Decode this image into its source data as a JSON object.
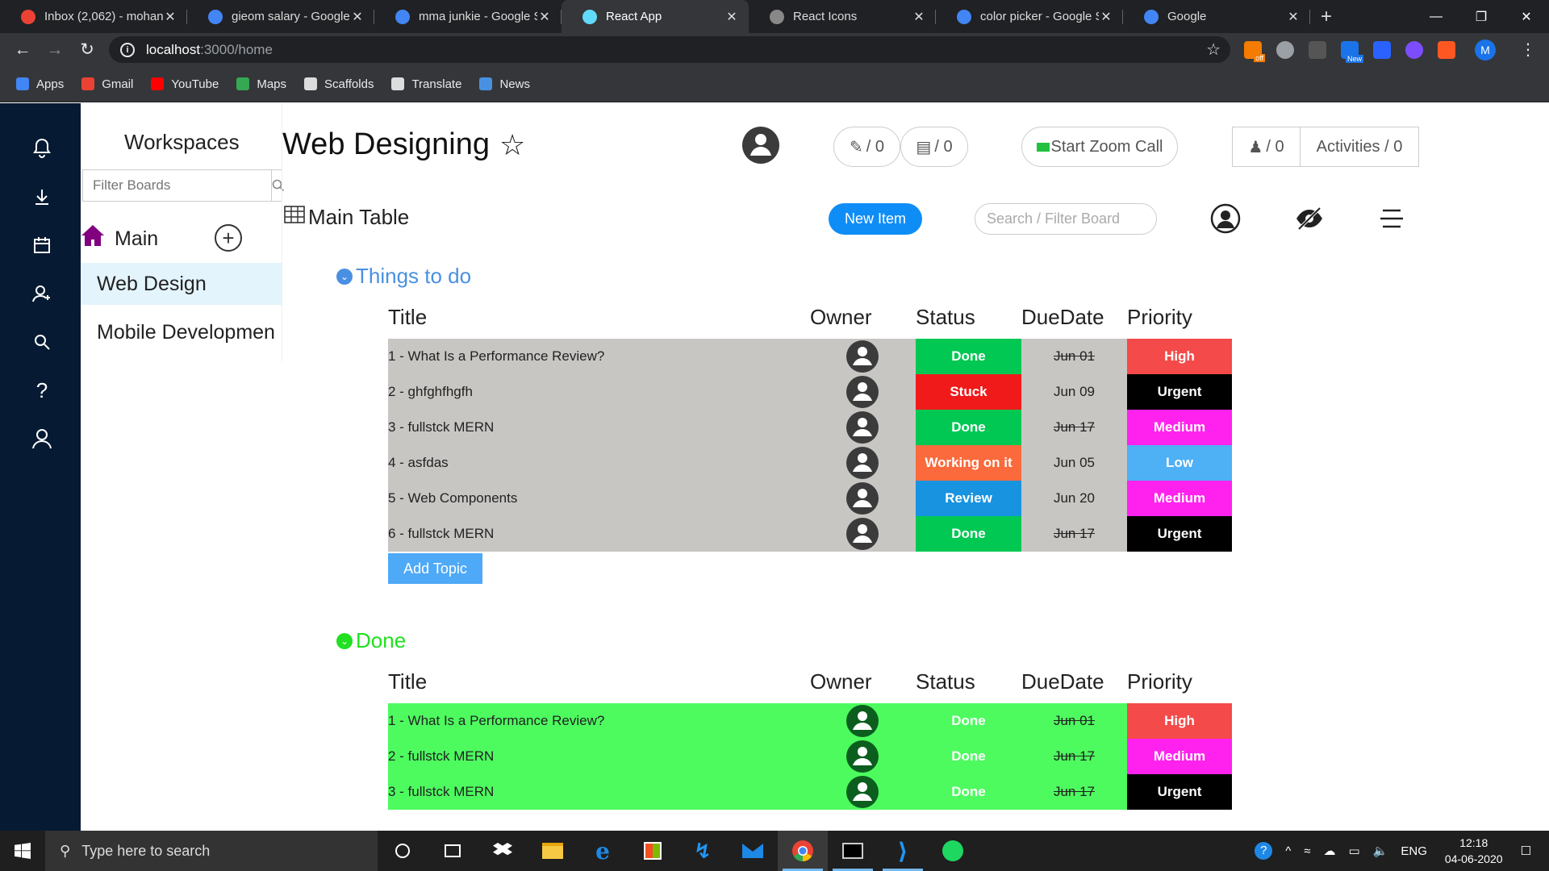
{
  "browser": {
    "tabs": [
      {
        "title": "Inbox (2,062) - mohann",
        "favicon": "gmail-icon",
        "color": "#ea4335",
        "active": false
      },
      {
        "title": "gieom salary - Google",
        "favicon": "google-icon",
        "color": "#4285f4",
        "active": false
      },
      {
        "title": "mma junkie - Google S",
        "favicon": "google-icon",
        "color": "#4285f4",
        "active": false
      },
      {
        "title": "React App",
        "favicon": "react-icon",
        "color": "#61dafb",
        "active": true
      },
      {
        "title": "React Icons",
        "favicon": "react-icons-icon",
        "color": "#888888",
        "active": false
      },
      {
        "title": "color picker - Google S",
        "favicon": "google-icon",
        "color": "#4285f4",
        "active": false
      },
      {
        "title": "Google",
        "favicon": "google-icon",
        "color": "#4285f4",
        "active": false
      }
    ],
    "url_host": "localhost",
    "url_path": ":3000/home",
    "bookmarks": [
      {
        "label": "Apps",
        "color": "#4285f4"
      },
      {
        "label": "Gmail",
        "color": "#ea4335"
      },
      {
        "label": "YouTube",
        "color": "#ff0000"
      },
      {
        "label": "Maps",
        "color": "#34a853"
      },
      {
        "label": "Scaffolds",
        "color": "#dddddd"
      },
      {
        "label": "Translate",
        "color": "#dddddd"
      },
      {
        "label": "News",
        "color": "#4a90e2"
      }
    ],
    "profile_initial": "M",
    "ext_badge_off": "off",
    "ext_badge_new": "New"
  },
  "sidebar": {
    "workspaces_title": "Workspaces",
    "filter_placeholder": "Filter Boards",
    "main_label": "Main",
    "boards": [
      {
        "label": "Web Design",
        "selected": true
      },
      {
        "label": "Mobile Developmen",
        "selected": false
      }
    ]
  },
  "header": {
    "board_title": "Web Designing",
    "pin_count": "/ 0",
    "notes_count": "/ 0",
    "zoom_label": "Start Zoom Call",
    "members_count": "/ 0",
    "activities_label": "Activities / 0",
    "view_label": "Main Table",
    "new_item_label": "New Item",
    "search_placeholder": "Search / Filter Board"
  },
  "columns": {
    "title": "Title",
    "owner": "Owner",
    "status": "Status",
    "due": "DueDate",
    "priority": "Priority"
  },
  "groups": [
    {
      "name": "Things to do",
      "color": "#4a90e2",
      "row_bg": "#c8c6c3",
      "owner_color": "#3b3b3b",
      "rows": [
        {
          "title": "1 - What Is a Performance Review?",
          "status": "Done",
          "status_color": "#00c853",
          "due": "Jun 01",
          "due_strike": true,
          "priority": "High",
          "priority_color": "#f44a4a"
        },
        {
          "title": "2 - ghfghfhgfh",
          "status": "Stuck",
          "status_color": "#f01a1a",
          "due": "Jun 09",
          "due_strike": false,
          "priority": "Urgent",
          "priority_color": "#000000"
        },
        {
          "title": "3 - fullstck MERN",
          "status": "Done",
          "status_color": "#00c853",
          "due": "Jun 17",
          "due_strike": true,
          "priority": "Medium",
          "priority_color": "#ff22ee"
        },
        {
          "title": "4 - asfdas",
          "status": "Working on it",
          "status_color": "#fa6a3c",
          "due": "Jun 05",
          "due_strike": false,
          "priority": "Low",
          "priority_color": "#4eb0f5"
        },
        {
          "title": "5 - Web Components",
          "status": "Review",
          "status_color": "#1893e0",
          "due": "Jun 20",
          "due_strike": false,
          "priority": "Medium",
          "priority_color": "#ff22ee"
        },
        {
          "title": "6 - fullstck MERN",
          "status": "Done",
          "status_color": "#00c853",
          "due": "Jun 17",
          "due_strike": true,
          "priority": "Urgent",
          "priority_color": "#000000"
        }
      ],
      "add_topic": "Add Topic"
    },
    {
      "name": "Done",
      "color": "#21e021",
      "row_bg": "#4dfb5f",
      "owner_color": "#0b5e1e",
      "rows": [
        {
          "title": "1 - What Is a Performance Review?",
          "status": "Done",
          "status_color": "#4dfb5f",
          "due": "Jun 01",
          "due_strike": true,
          "priority": "High",
          "priority_color": "#f44a4a"
        },
        {
          "title": "2 - fullstck MERN",
          "status": "Done",
          "status_color": "#4dfb5f",
          "due": "Jun 17",
          "due_strike": true,
          "priority": "Medium",
          "priority_color": "#ff22ee"
        },
        {
          "title": "3 - fullstck MERN",
          "status": "Done",
          "status_color": "#4dfb5f",
          "due": "Jun 17",
          "due_strike": true,
          "priority": "Urgent",
          "priority_color": "#000000"
        }
      ]
    }
  ],
  "taskbar": {
    "search_placeholder": "Type here to search",
    "language": "ENG",
    "time": "12:18",
    "date": "04-06-2020"
  }
}
